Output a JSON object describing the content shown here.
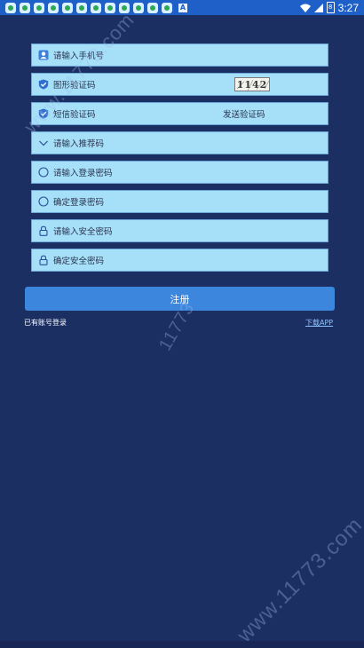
{
  "status_bar": {
    "notification_count": 13,
    "time": "3:27",
    "battery_level": "8",
    "notif_badge": "A"
  },
  "form": {
    "phone": {
      "placeholder": "请输入手机号",
      "icon": "user-icon"
    },
    "captcha": {
      "label": "图形验证码",
      "icon": "shield-check-icon",
      "image_text": "1142"
    },
    "sms": {
      "label": "短信验证码",
      "icon": "shield-check-icon",
      "send_label": "发送验证码"
    },
    "referral": {
      "placeholder": "请输入推荐码",
      "icon": "chevron-down-icon"
    },
    "login_password": {
      "placeholder": "请输入登录密码",
      "icon": "circle-icon"
    },
    "confirm_login_password": {
      "placeholder": "确定登录密码",
      "icon": "circle-icon"
    },
    "security_password": {
      "placeholder": "请输入安全密码",
      "icon": "lock-icon"
    },
    "confirm_security_password": {
      "placeholder": "确定安全密码",
      "icon": "lock-icon"
    }
  },
  "register_button": "注册",
  "links": {
    "have_account": "已有账号登录",
    "download_app": "下载APP"
  },
  "watermarks": [
    "www.11773.com",
    "11773",
    "www.11773.com"
  ],
  "colors": {
    "background": "#1c2f63",
    "field": "#a5dff8",
    "button": "#3c86de",
    "status_bar": "#1e60c8"
  }
}
